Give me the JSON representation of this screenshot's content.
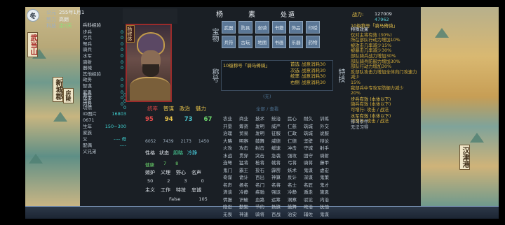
{
  "season_badge": "冬",
  "top_info": {
    "era_label": "公元",
    "era_value": "255年1月1",
    "faction_label": "势力",
    "faction_value": "高朗",
    "tech_label": "科技",
    "tech_value": "余0天"
  },
  "stats": {
    "header": "兵科经验",
    "rows": [
      {
        "k": "步兵",
        "v": "0"
      },
      {
        "k": "弓兵",
        "v": "0"
      },
      {
        "k": "弩兵",
        "v": "0"
      },
      {
        "k": "骑兵",
        "v": "0"
      },
      {
        "k": "水军",
        "v": "0"
      },
      {
        "k": "骑射",
        "v": "0"
      },
      {
        "k": "器械",
        "v": "0"
      },
      {
        "k": "其他经验",
        "v": ""
      },
      {
        "k": "政务",
        "v": "0"
      },
      {
        "k": "智谋",
        "v": "0"
      },
      {
        "k": "武勇",
        "v": "0"
      },
      {
        "k": "统率",
        "v": "0"
      },
      {
        "k": "内政",
        "v": "0"
      }
    ]
  },
  "left_mid": [
    {
      "k": "兼任",
      "v": "0"
    },
    {
      "k": "声名",
      "v": "0"
    },
    {
      "k": "功绩",
      "v": "0"
    },
    {
      "k": "ID图片",
      "v": "16803"
    },
    {
      "k": "0671",
      "v": ""
    },
    {
      "k": "生年",
      "v": "150~300"
    },
    {
      "k": "家族",
      "v": ""
    },
    {
      "k": "父",
      "v": "----  母"
    },
    {
      "k": "配偶",
      "v": "----"
    },
    {
      "k": "义兄弟",
      "v": ""
    }
  ],
  "portrait": {
    "name_tag": "杨修体"
  },
  "abilities": {
    "labels": [
      "统率",
      "智谋",
      "政治",
      "魅力"
    ],
    "values": [
      "95",
      "94",
      "73",
      "67"
    ]
  },
  "big_numbers": [
    "6052",
    "7439",
    "2173",
    "1450"
  ],
  "traits": {
    "row1": [
      "性格",
      "状态",
      "胆略",
      "冷静"
    ],
    "row1_states": [
      "",
      "",
      "good",
      "calm"
    ],
    "misc1": [
      "健康",
      "7",
      "8"
    ],
    "row2": [
      "嫉妒",
      "义理",
      "野心",
      "名声"
    ],
    "misc2": [
      "50",
      "2",
      "3",
      "0"
    ],
    "row3": [
      "主义",
      "工作",
      "特技",
      "忠诚"
    ],
    "misc3": [
      "",
      "False",
      "105"
    ]
  },
  "header": {
    "surname": "杨",
    "given_name": "素",
    "subtitle": "处遁"
  },
  "section_labels": {
    "treasure": "宝物",
    "title": "称号",
    "skill": "特技"
  },
  "treasure_items": [
    "武器",
    "防具",
    "坐骑",
    "书籍",
    "饰品",
    "印绶",
    "兵符",
    "古玩",
    "地图",
    "书画",
    "乐器",
    "药物"
  ],
  "title_block": {
    "head": "10级称号「骑马倚骑」",
    "lines": [
      {
        "k": "首选",
        "v": "战意消耗30"
      },
      {
        "k": "次选",
        "v": "战意消耗30"
      },
      {
        "k": "统率",
        "v": "战意消耗30"
      },
      {
        "k": "右侧",
        "v": "战意消耗30"
      }
    ],
    "footer_top": "(无)",
    "footer": "全部 / 查看"
  },
  "skill_grid": [
    "农业",
    "商业",
    "技术",
    "统治",
    "民心",
    "耐久",
    "训练",
    "开垦",
    "筹资",
    "发明",
    "威严",
    "仁慈",
    "筑城",
    "外交",
    "治理",
    "贸易",
    "发明",
    "征服",
    "仁政",
    "筑城",
    "说服",
    "大略",
    "明察",
    "鼓舞",
    "威德",
    "仁德",
    "坚壁",
    "辩论",
    "火攻",
    "攻击",
    "射击",
    "缓速",
    "冲击",
    "守城",
    "射手",
    "水战",
    "贯穿",
    "突击",
    "急袭",
    "强攻",
    "固守",
    "骑射",
    "连弩",
    "猛将",
    "枪将",
    "戟将",
    "弓将",
    "骑将",
    "藤甲",
    "鬼门",
    "霸王",
    "投石",
    "霹雳",
    "妖术",
    "鬼谋",
    "虚宏",
    "奇谋",
    "诡计",
    "百出",
    "神算",
    "反计",
    "深谋",
    "鬼策",
    "名声",
    "扬名",
    "名门",
    "名将",
    "名士",
    "名匠",
    "鬼才",
    "清谈",
    "冷静",
    "疾驰",
    "强运",
    "冷静",
    "遁走",
    "施恩",
    "情报",
    "识破",
    "血路",
    "运筹",
    "洞察",
    "驳论",
    "内治",
    "隐忍",
    "勤勉",
    "节约",
    "扬旗",
    "鼓舞",
    "政治",
    "抚恤",
    "无畏",
    "神速",
    "骑将",
    "百战",
    "治安",
    "辅佐",
    "鬼谋"
  ],
  "power": {
    "label": "战力:",
    "value": "127009",
    "sub": "47962"
  },
  "skill_detail": {
    "head": "10级称号「骑马倚骑」",
    "lines": [
      "特殊效果",
      "仅对主将有效 (30%)",
      "所在部队行动力增加10%",
      "被攻击几率减少15%",
      "被暴击几率减少30%",
      "部队骑兵战力增加30%",
      "部队骑兵防御力增加30%",
      "部队行动力增加30%",
      "反部队攻击力增加全体向门攻速力减少",
      "15%",
      "我部兵中专攻军防御力减少",
      "20%"
    ],
    "sec1": "步兵有效 (本体以下)",
    "sec1_lines": [
      "骑兵有效 (本体以下)",
      "可增行: 攻击 / 战法"
    ],
    "sec2": "水军有效 (本体以下)",
    "sec2_lines": [
      "可增行: 攻击 / 战法"
    ],
    "learn_label": "修习条件",
    "learn_value": "无法习得"
  },
  "colors": {
    "accent_red": "#9b2b2b",
    "gold": "#e8c34a",
    "cyan": "#3fd2d2"
  },
  "map_labels": {
    "left1": "武当山",
    "left2": "新城郡",
    "left3": "房陵",
    "right1": "汉津港"
  }
}
